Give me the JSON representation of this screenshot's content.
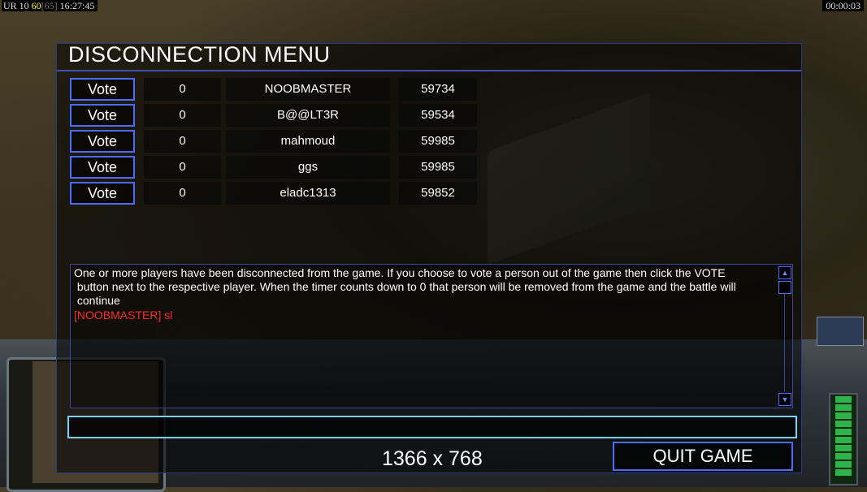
{
  "hud": {
    "top_left_prefix": "UR",
    "top_left_a": "10",
    "top_left_b": "60",
    "top_left_c": "[65]",
    "top_left_time": "16:27:45",
    "timer": "00:00:03"
  },
  "dialog": {
    "title": "DISCONNECTION MENU",
    "vote_label": "Vote",
    "players": [
      {
        "votes": "0",
        "name": "NOOBMASTER",
        "ping": "59734"
      },
      {
        "votes": "0",
        "name": "B@@LT3R",
        "ping": "59534"
      },
      {
        "votes": "0",
        "name": "mahmoud",
        "ping": "59985"
      },
      {
        "votes": "0",
        "name": "ggs",
        "ping": "59985"
      },
      {
        "votes": "0",
        "name": "eladc1313",
        "ping": "59852"
      }
    ],
    "message_lines": [
      "One or more players have been disconnected from the game. If you choose to vote a person out of the game then click the VOTE",
      " button next to the respective player. When the timer counts down to 0 that person will be removed from the game and the battle will",
      " continue"
    ],
    "chat_line": "[NOOBMASTER] sl",
    "chat_input_value": "",
    "resolution": "1366 x 768",
    "quit_label": "QUIT GAME"
  },
  "colors": {
    "accent_border": "#4a6cff",
    "chat_red": "#ff2a2a",
    "input_border": "#7ad3ff"
  }
}
